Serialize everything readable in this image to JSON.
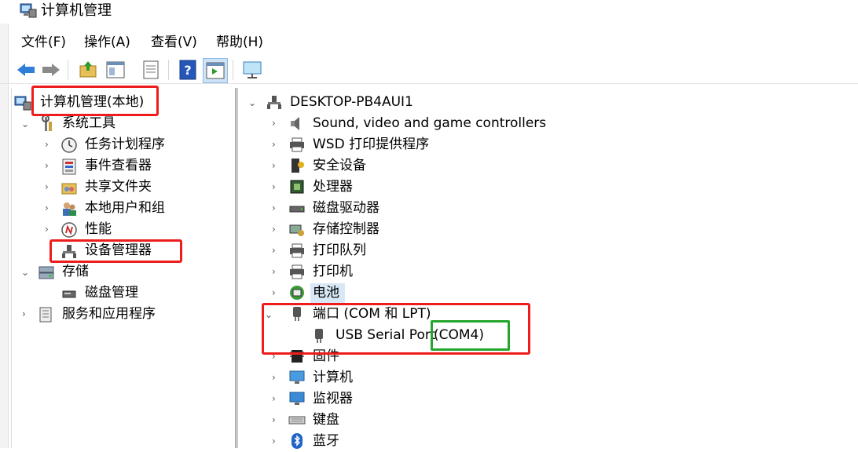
{
  "window": {
    "title": "计算机管理"
  },
  "menu": [
    "文件(F)",
    "操作(A)",
    "查看(V)",
    "帮助(H)"
  ],
  "toolbar": {
    "buttons": [
      "back-icon",
      "forward-icon",
      "up-folder-icon",
      "show-hide-tree-icon",
      "properties-icon",
      "help-icon",
      "action-pane-icon",
      "monitor-icon"
    ]
  },
  "left_tree": {
    "root": "计算机管理(本地)",
    "system_tools": "系统工具",
    "task_scheduler": "任务计划程序",
    "event_viewer": "事件查看器",
    "shared_folders": "共享文件夹",
    "local_users": "本地用户和组",
    "performance": "性能",
    "device_manager": "设备管理器",
    "storage": "存储",
    "disk_management": "磁盘管理",
    "services_apps": "服务和应用程序"
  },
  "right_tree": {
    "computer": "DESKTOP-PB4AUI1",
    "items": [
      "Sound, video and game controllers",
      "WSD 打印提供程序",
      "安全设备",
      "处理器",
      "磁盘驱动器",
      "存储控制器",
      "打印队列",
      "打印机",
      "电池",
      "端口 (COM 和 LPT)",
      "固件",
      "计算机",
      "监视器",
      "键盘",
      "蓝牙"
    ],
    "port_child_name": "USB Serial Port",
    "port_child_com": "(COM4)"
  },
  "colors": {
    "highlight_red": "#ee1c1c",
    "highlight_green": "#24a52b",
    "selection": "#d9e8f6"
  }
}
